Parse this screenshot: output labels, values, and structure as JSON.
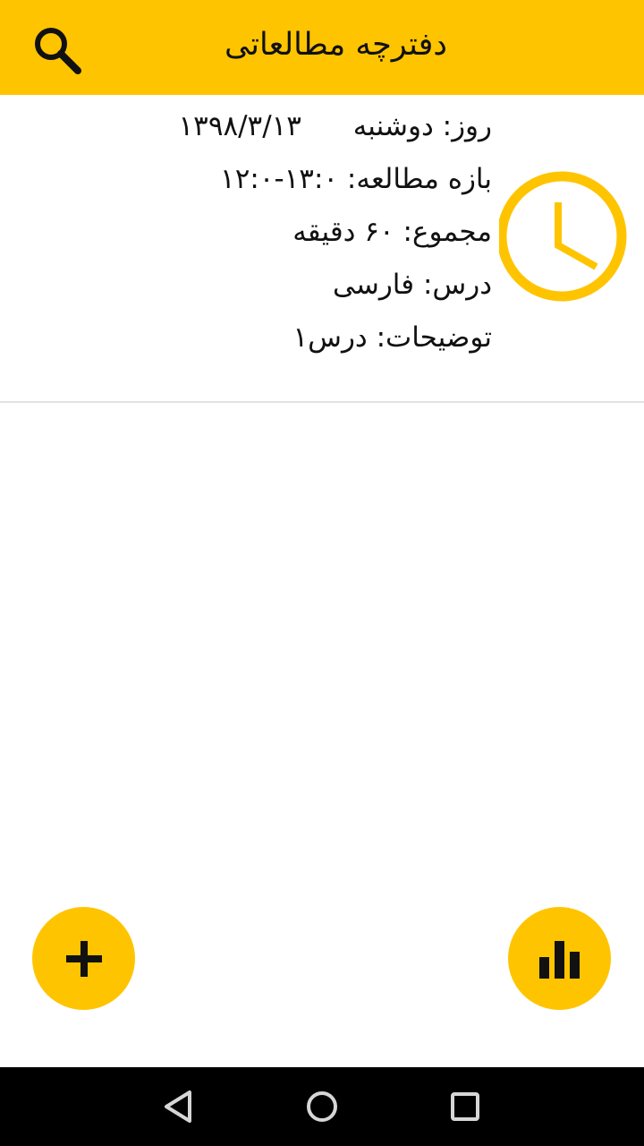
{
  "appbar": {
    "title": "دفترچه مطالعاتی",
    "search_icon": "search-icon"
  },
  "record": {
    "day_label": "روز:",
    "day_name": "دوشنبه",
    "date": "۱۳۹۸/۳/۱۳",
    "range_label": "بازه مطالعه:",
    "range_value": "۱۳:۰-۱۲:۰",
    "total_label": "مجموع:",
    "total_value": "۶۰ دقیقه",
    "lesson_label": "درس:",
    "lesson_value": "فارسی",
    "notes_label": "توضیحات:",
    "notes_value": "درس۱",
    "icon": "clock-icon"
  },
  "fabs": {
    "add_icon": "plus-icon",
    "stats_icon": "bar-chart-icon"
  },
  "navbar": {
    "back_icon": "back-triangle-icon",
    "home_icon": "home-circle-icon",
    "recent_icon": "recent-square-icon"
  },
  "colors": {
    "accent": "#FFC400",
    "text": "#111111",
    "divider": "#e2e2e2",
    "navbar": "#000000"
  }
}
